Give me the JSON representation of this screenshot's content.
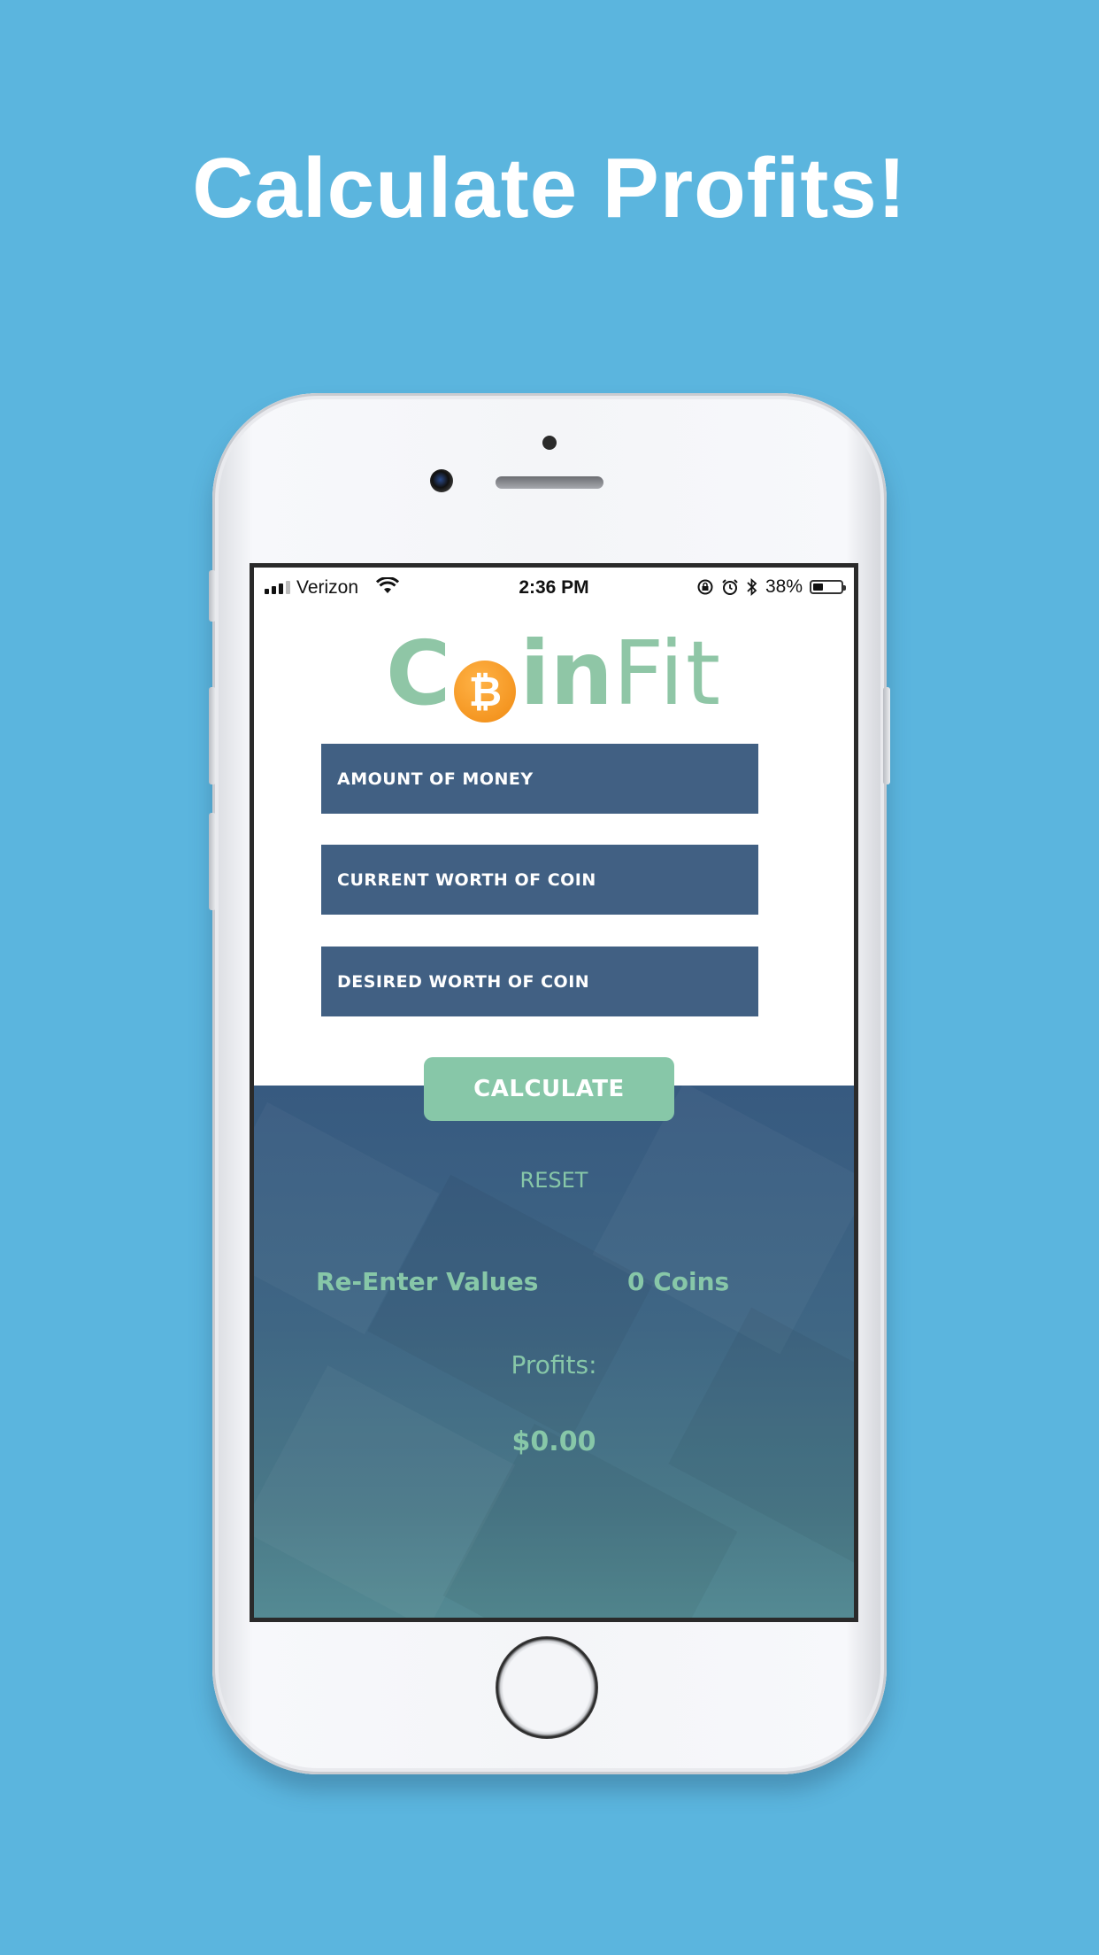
{
  "headline": "Calculate Profits!",
  "status_bar": {
    "carrier": "Verizon",
    "time": "2:36 PM",
    "battery_percent": "38%",
    "battery_level": 0.38,
    "icons": [
      "signal-icon",
      "wifi-icon",
      "rotation-lock-icon",
      "alarm-icon",
      "bluetooth-icon",
      "battery-icon"
    ]
  },
  "logo": {
    "part1_letter": "C",
    "coin_symbol": "₿",
    "part1_rest": "in",
    "part2": "Fit",
    "green": "#8fc6a6",
    "orange": "#f39a1e"
  },
  "form": {
    "amount_placeholder": "AMOUNT OF MONEY",
    "current_worth_placeholder": "CURRENT WORTH OF COIN",
    "desired_worth_placeholder": "DESIRED WORTH OF COIN",
    "field_color": "#416083"
  },
  "actions": {
    "calculate_label": "CALCULATE",
    "reset_label": "RESET",
    "accent": "#87c7a8"
  },
  "results": {
    "message": "Re-Enter Values",
    "coins": "0 Coins",
    "profits_label": "Profits:",
    "profits_value": "$0.00"
  }
}
